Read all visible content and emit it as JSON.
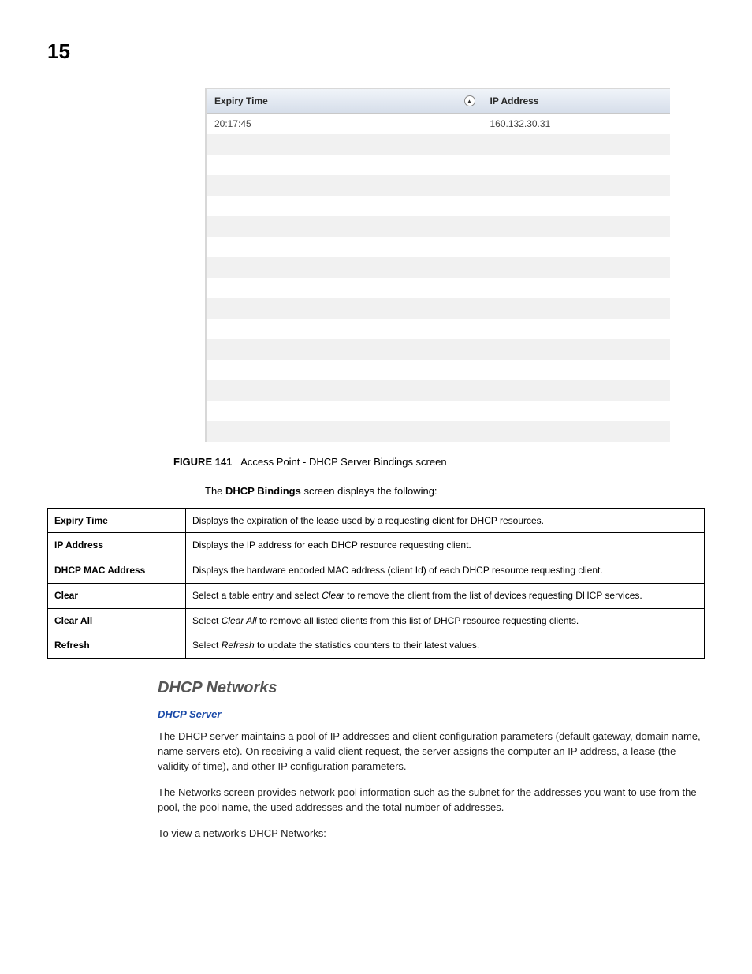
{
  "page_number": "15",
  "screenshot": {
    "columns": {
      "expiry": "Expiry Time",
      "ip": "IP Address"
    },
    "rows": [
      {
        "expiry": "20:17:45",
        "ip": "160.132.30.31"
      },
      {
        "expiry": "",
        "ip": ""
      },
      {
        "expiry": "",
        "ip": ""
      },
      {
        "expiry": "",
        "ip": ""
      },
      {
        "expiry": "",
        "ip": ""
      },
      {
        "expiry": "",
        "ip": ""
      },
      {
        "expiry": "",
        "ip": ""
      },
      {
        "expiry": "",
        "ip": ""
      },
      {
        "expiry": "",
        "ip": ""
      },
      {
        "expiry": "",
        "ip": ""
      },
      {
        "expiry": "",
        "ip": ""
      },
      {
        "expiry": "",
        "ip": ""
      },
      {
        "expiry": "",
        "ip": ""
      },
      {
        "expiry": "",
        "ip": ""
      },
      {
        "expiry": "",
        "ip": ""
      },
      {
        "expiry": "",
        "ip": ""
      }
    ]
  },
  "figure": {
    "label": "FIGURE 141",
    "caption": "Access Point - DHCP Server Bindings screen"
  },
  "intro": {
    "prefix": "The ",
    "bold": "DHCP Bindings",
    "suffix": " screen displays the following:"
  },
  "descriptions": [
    {
      "term": "Expiry Time",
      "text": "Displays the expiration of the lease used by a requesting client for DHCP resources."
    },
    {
      "term": "IP Address",
      "text": "Displays the IP address for each DHCP resource requesting client."
    },
    {
      "term": "DHCP MAC Address",
      "text": "Displays the hardware encoded MAC address (client Id) of each DHCP resource requesting client."
    },
    {
      "term": "Clear",
      "pre": "Select a table entry and select ",
      "italic": "Clear",
      "post": " to remove the client from the list of devices requesting DHCP services."
    },
    {
      "term": "Clear All",
      "pre": "Select ",
      "italic": "Clear All",
      "post": " to remove all listed clients from this list of DHCP resource requesting clients."
    },
    {
      "term": "Refresh",
      "pre": "Select ",
      "italic": "Refresh",
      "post": " to update the statistics counters to their latest values."
    }
  ],
  "section": {
    "heading": "DHCP Networks",
    "link": "DHCP Server",
    "para1": "The DHCP server maintains a pool of IP addresses and client configuration parameters (default gateway, domain name, name servers etc). On receiving a valid client request, the server assigns the computer an IP address, a lease (the validity of time), and other IP configuration parameters.",
    "para2": "The Networks screen provides network pool information such as the subnet for the addresses you want to use from the pool, the pool name, the used addresses and the total number of addresses.",
    "para3": "To view a network's DHCP Networks:"
  }
}
